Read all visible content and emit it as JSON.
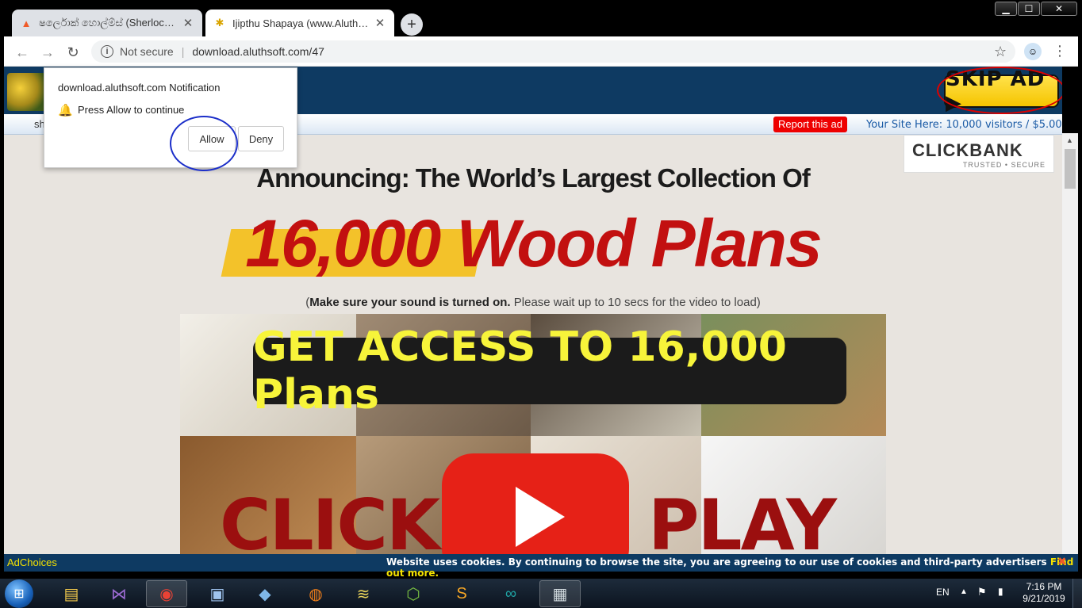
{
  "browser": {
    "tabs": [
      {
        "title": "ෂර්ලොක් හොල්ම්ස් (Sherlock Holm",
        "favicon": "A",
        "active": false
      },
      {
        "title": "Ijipthu Shapaya (www.Aluthosft.c",
        "favicon": "bee-icon",
        "active": true
      }
    ],
    "new_tab": "+",
    "window_controls": {
      "minimize": "▁",
      "maximize": "☐",
      "close": "✕"
    },
    "security": "Not secure",
    "url": "download.aluthsoft.com/47"
  },
  "notification": {
    "origin": "download.aluthsoft.com Notification",
    "message": "Press Allow to continue",
    "allow": "Allow",
    "deny": "Deny"
  },
  "site": {
    "skip_ad": "SKIP AD ▶",
    "ad_bar_text": "sh",
    "report_ad": "Report this ad",
    "site_here": "Your Site Here: 10,000 visitors / $5.00",
    "clickbank_brand": "CLICKBANK",
    "clickbank_tag": "TRUSTED • SECURE",
    "announce": "Announcing: The World’s Largest Collection Of",
    "headline": "16,000 Wood Plans",
    "sound_note_bold": "Make sure your sound is turned on.",
    "sound_note_rest": " Please wait up to 10 secs for the video to load)",
    "sound_note_open": "(",
    "access_banner": "GET ACCESS TO 16,000 Plans",
    "click": "CLICK",
    "play": "PLAY"
  },
  "cookie_bar": {
    "adchoices": "AdChoices",
    "message": "Website uses cookies. By continuing to browse the site, you are agreeing to our use of cookies and third-party advertisers ",
    "link": "Find out more.",
    "close": "✖"
  },
  "taskbar": {
    "language": "EN",
    "time": "7:16 PM",
    "date": "9/21/2019"
  },
  "colors": {
    "site_header": "#0e3a62",
    "headline_red": "#c21010",
    "banner_yellow": "#f7f43a",
    "youtube_red": "#e62117"
  }
}
